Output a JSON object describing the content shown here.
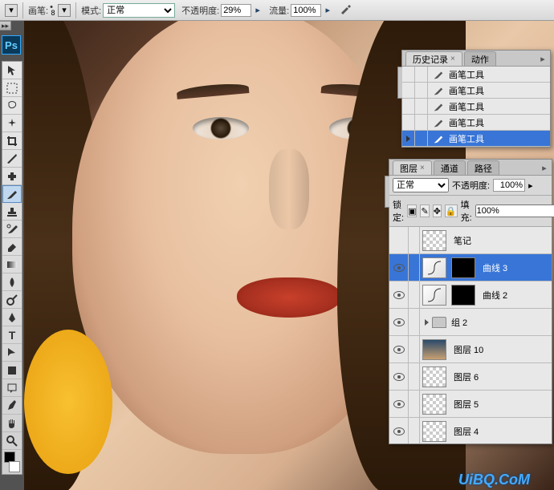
{
  "optbar": {
    "brush_label": "画笔:",
    "brush_size": "8",
    "mode_label": "模式:",
    "mode_value": "正常",
    "opacity_label": "不透明度:",
    "opacity_value": "29%",
    "flow_label": "流量:",
    "flow_value": "100%"
  },
  "ps_logo": "Ps",
  "history_panel": {
    "tab1": "历史记录",
    "tab2": "动作",
    "items": [
      "画笔工具",
      "画笔工具",
      "画笔工具",
      "画笔工具",
      "画笔工具"
    ]
  },
  "layers_panel": {
    "tabs": [
      "图层",
      "通道",
      "路径"
    ],
    "blend_value": "正常",
    "opacity_label": "不透明度:",
    "opacity_value": "100%",
    "lock_label": "锁定:",
    "fill_label": "填充:",
    "fill_value": "100%",
    "layers": [
      {
        "name": "笔记",
        "type": "trans",
        "vis": false
      },
      {
        "name": "曲线 3",
        "type": "curves",
        "vis": true,
        "sel": true
      },
      {
        "name": "曲线 2",
        "type": "curves",
        "vis": true
      },
      {
        "name": "组 2",
        "type": "group",
        "vis": true
      },
      {
        "name": "图层 10",
        "type": "img",
        "vis": true
      },
      {
        "name": "图层 6",
        "type": "trans",
        "vis": true
      },
      {
        "name": "图层 5",
        "type": "trans",
        "vis": true
      },
      {
        "name": "图层 4",
        "type": "trans",
        "vis": true
      }
    ]
  },
  "watermark": "UiBQ.CoM"
}
